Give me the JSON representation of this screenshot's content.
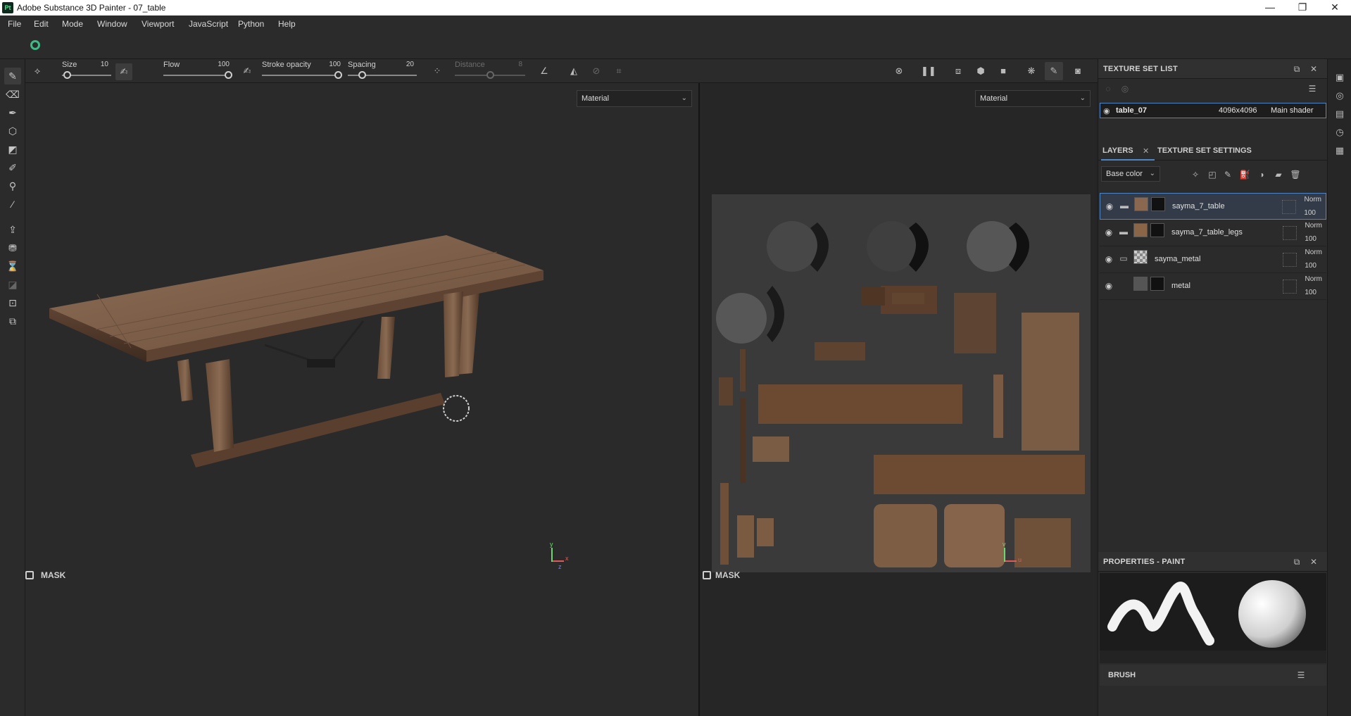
{
  "window": {
    "title": "Adobe Substance 3D Painter - 07_table",
    "app_badge": "Pt",
    "minimize": "—",
    "maximize": "❐",
    "close": "✕"
  },
  "menu": [
    "File",
    "Edit",
    "Mode",
    "Window",
    "Viewport",
    "JavaScript",
    "Python",
    "Help"
  ],
  "tool_props": {
    "size_label": "Size",
    "size_value": "10",
    "flow_label": "Flow",
    "flow_value": "100",
    "stroke_label": "Stroke opacity",
    "stroke_value": "100",
    "spacing_label": "Spacing",
    "spacing_value": "20",
    "distance_label": "Distance",
    "distance_value": "8",
    "size_level": 0.1,
    "flow_level": 1.0,
    "stroke_level": 1.0,
    "spacing_level": 0.2,
    "distance_level": 0.5
  },
  "viewport3d": {
    "dropdown": "Material",
    "mask_label": "MASK"
  },
  "viewport2d": {
    "dropdown": "Material",
    "mask_label": "MASK"
  },
  "texture_set_list": {
    "title": "TEXTURE SET LIST",
    "row": {
      "name": "table_07",
      "resolution": "4096x4096",
      "shader": "Main shader"
    }
  },
  "layers_panel": {
    "tab_layers": "LAYERS",
    "tab_settings": "TEXTURE SET SETTINGS",
    "channel_dropdown": "Base color",
    "layers": [
      {
        "name": "sayma_7_table",
        "blend": "Norm",
        "opacity": "100",
        "type": "folder"
      },
      {
        "name": "sayma_7_table_legs",
        "blend": "Norm",
        "opacity": "100",
        "type": "folder"
      },
      {
        "name": "sayma_metal",
        "blend": "Norm",
        "opacity": "100",
        "type": "folder-open"
      },
      {
        "name": "metal",
        "blend": "Norm",
        "opacity": "100",
        "type": "fill"
      }
    ]
  },
  "properties": {
    "title": "PROPERTIES - PAINT",
    "brush_label": "BRUSH"
  },
  "colors": {
    "accent_blue": "#4c86c6",
    "logo_green": "#3df08a",
    "panel_bg": "#2b2b2b",
    "viewport_bg": "#2a2a2a",
    "wood": "#7a5a43"
  }
}
